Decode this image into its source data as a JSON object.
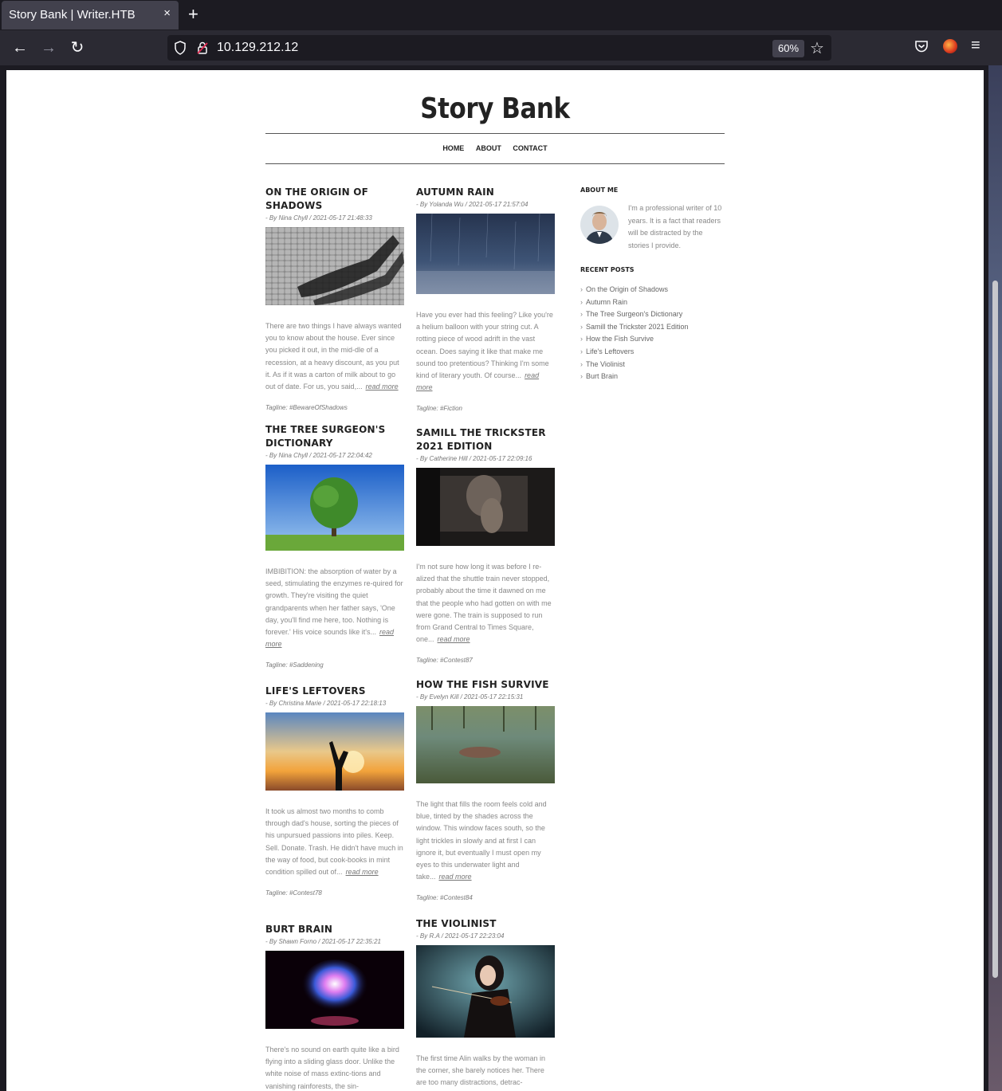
{
  "browser": {
    "tab_title": "Story Bank | Writer.HTB",
    "tab_close": "×",
    "new_tab": "+",
    "url": "10.129.212.12",
    "zoom": "60%",
    "back_icon": "←",
    "forward_icon": "→",
    "reload_icon": "↻",
    "star_icon": "☆",
    "menu_icon": "≡"
  },
  "site": {
    "title": "Story Bank",
    "menu": [
      "HOME",
      "ABOUT",
      "CONTACT"
    ]
  },
  "posts": [
    {
      "title": "ON THE ORIGIN OF SHADOWS",
      "meta": "- By Nina Chyll / 2021-05-17 21:48:33",
      "excerpt": "There are two things I have always wanted you to know about the house. Ever since you picked it out, in the mid-dle of a recession, at a heavy discount, as you put it. As if it was a carton of milk about to go out of date. For us, you said,...",
      "read_more": "read more",
      "tagline": "Tagline: #BewareOfShadows"
    },
    {
      "title": "AUTUMN RAIN",
      "meta": "- By Yolanda Wu / 2021-05-17 21:57:04",
      "excerpt": "Have you ever had this feeling? Like you're a helium balloon with your string cut. A rotting piece of wood adrift in the vast ocean. Does saying it like that make me sound too pretentious? Thinking I'm some kind of literary youth. Of course...",
      "read_more": "read more",
      "tagline": "Tagline: #Fiction"
    },
    {
      "title": "THE TREE SURGEON'S DICTIONARY",
      "meta": "- By Nina Chyll / 2021-05-17 22:04:42",
      "excerpt": "IMBIBITION: the absorption of water by a seed, stimulating the enzymes re-quired for growth. They're visiting the quiet grandparents when her father says, 'One day, you'll find me here, too. Nothing is forever.' His voice sounds like it's...",
      "read_more": "read more",
      "tagline": "Tagline: #Saddening"
    },
    {
      "title": "SAMILL THE TRICKSTER 2021 EDITION",
      "meta": "- By Catherine Hill / 2021-05-17 22:09:16",
      "excerpt": "I'm not sure how long it was before I re-alized that the shuttle train never stopped, probably about the time it dawned on me that the people who had gotten on with me were gone. The train is supposed to run from Grand Central to Times Square, one...",
      "read_more": "read more",
      "tagline": "Tagline: #Contest87"
    },
    {
      "title": "LIFE'S LEFTOVERS",
      "meta": "- By Christina Marie / 2021-05-17 22:18:13",
      "excerpt": "It took us almost two months to comb through dad's house, sorting the pieces of his unpursued passions into piles. Keep. Sell. Donate. Trash. He didn't have much in the way of food, but cook-books in mint condition spilled out of...",
      "read_more": "read more",
      "tagline": "Tagline: #Contest78"
    },
    {
      "title": "HOW THE FISH SURVIVE",
      "meta": "- By Evelyn Kill / 2021-05-17 22:15:31",
      "excerpt": "The light that fills the room feels cold and blue, tinted by the shades across the window. This window faces south, so the light trickles in slowly and at first I can ignore it, but eventually I must open my eyes to this underwater light and take...",
      "read_more": "read more",
      "tagline": "Tagline: #Contest84"
    },
    {
      "title": "BURT BRAIN",
      "meta": "- By Shawn Forno / 2021-05-17 22:35:21",
      "excerpt": "There's no sound on earth quite like a bird flying into a sliding glass door. Unlike the white noise of mass extinc-tions and vanishing rainforests, the sin-",
      "read_more": "",
      "tagline": ""
    },
    {
      "title": "THE VIOLINIST",
      "meta": "- By R.A / 2021-05-17 22:23:04",
      "excerpt": "The first time Alin walks by the woman in the corner, she barely notices her. There are too many distractions, detrac-",
      "read_more": "",
      "tagline": ""
    }
  ],
  "sidebar": {
    "about_heading": "ABOUT ME",
    "about_text": "I'm a professional writer of 10 years. It is a fact that readers will be distracted by the stories I provide.",
    "recent_heading": "RECENT POSTS",
    "recent_posts": [
      "On the Origin of Shadows",
      "Autumn Rain",
      "The Tree Surgeon's Dictionary",
      "Samill the Trickster 2021 Edition",
      "How the Fish Survive",
      "Life's Leftovers",
      "The Violinist",
      "Burt Brain"
    ]
  }
}
